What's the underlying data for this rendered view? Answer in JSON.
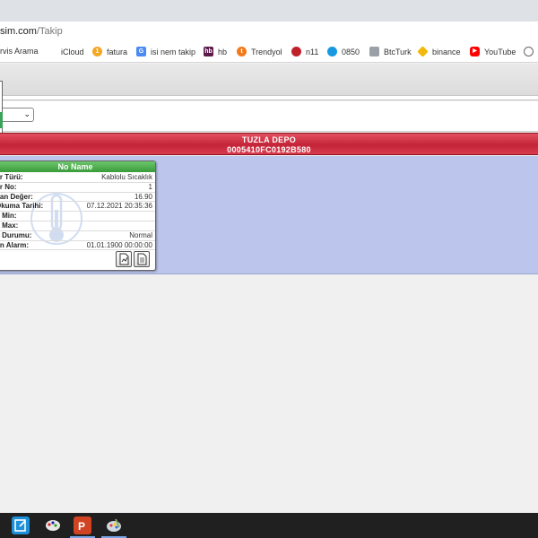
{
  "browser": {
    "url_domain": "sim.com",
    "url_path": "/Takip",
    "bookmarks": [
      {
        "label": "rvis Arama",
        "icon": "partial-icon"
      },
      {
        "label": "iCloud",
        "icon": "apple-icon"
      },
      {
        "label": "fatura",
        "icon": "fatura-icon"
      },
      {
        "label": "isi nem takip",
        "icon": "translate-icon"
      },
      {
        "label": "hb",
        "icon": "hb-icon"
      },
      {
        "label": "Trendyol",
        "icon": "trendyol-icon"
      },
      {
        "label": "n11",
        "icon": "ladybug-icon"
      },
      {
        "label": "0850",
        "icon": "cloud-icon"
      },
      {
        "label": "BtcTurk",
        "icon": "btcturk-icon"
      },
      {
        "label": "binance",
        "icon": "binance-icon"
      },
      {
        "label": "YouTube",
        "icon": "youtube-icon"
      },
      {
        "label": "",
        "icon": "globe-icon"
      }
    ]
  },
  "depot": {
    "name": "TUZLA DEPO",
    "id": "0005410FC0192B580"
  },
  "sensor_card": {
    "title": "No Name",
    "rows": [
      {
        "label": "ör Türü:",
        "value": "Kablolu Sıcaklık"
      },
      {
        "label": "ör No:",
        "value": "1"
      },
      {
        "label": "nan Değer:",
        "value": "16.90"
      },
      {
        "label": "Okuma Tarihi:",
        "value": "07.12.2021 20:35:36"
      },
      {
        "label": "n Min:",
        "value": ""
      },
      {
        "label": "n Max:",
        "value": ""
      },
      {
        "label": "n Durumu:",
        "value": "Normal"
      },
      {
        "label": "on Alarm:",
        "value": "01.01.1900 00:00:00"
      }
    ]
  },
  "colors": {
    "depot_header": "#c42438",
    "depot_body": "#bcc6ec",
    "card_title": "#3a9b3a"
  },
  "taskbar": {
    "apps": [
      "note-icon",
      "paint-icon",
      "powerpoint-icon",
      "palette-icon"
    ]
  }
}
